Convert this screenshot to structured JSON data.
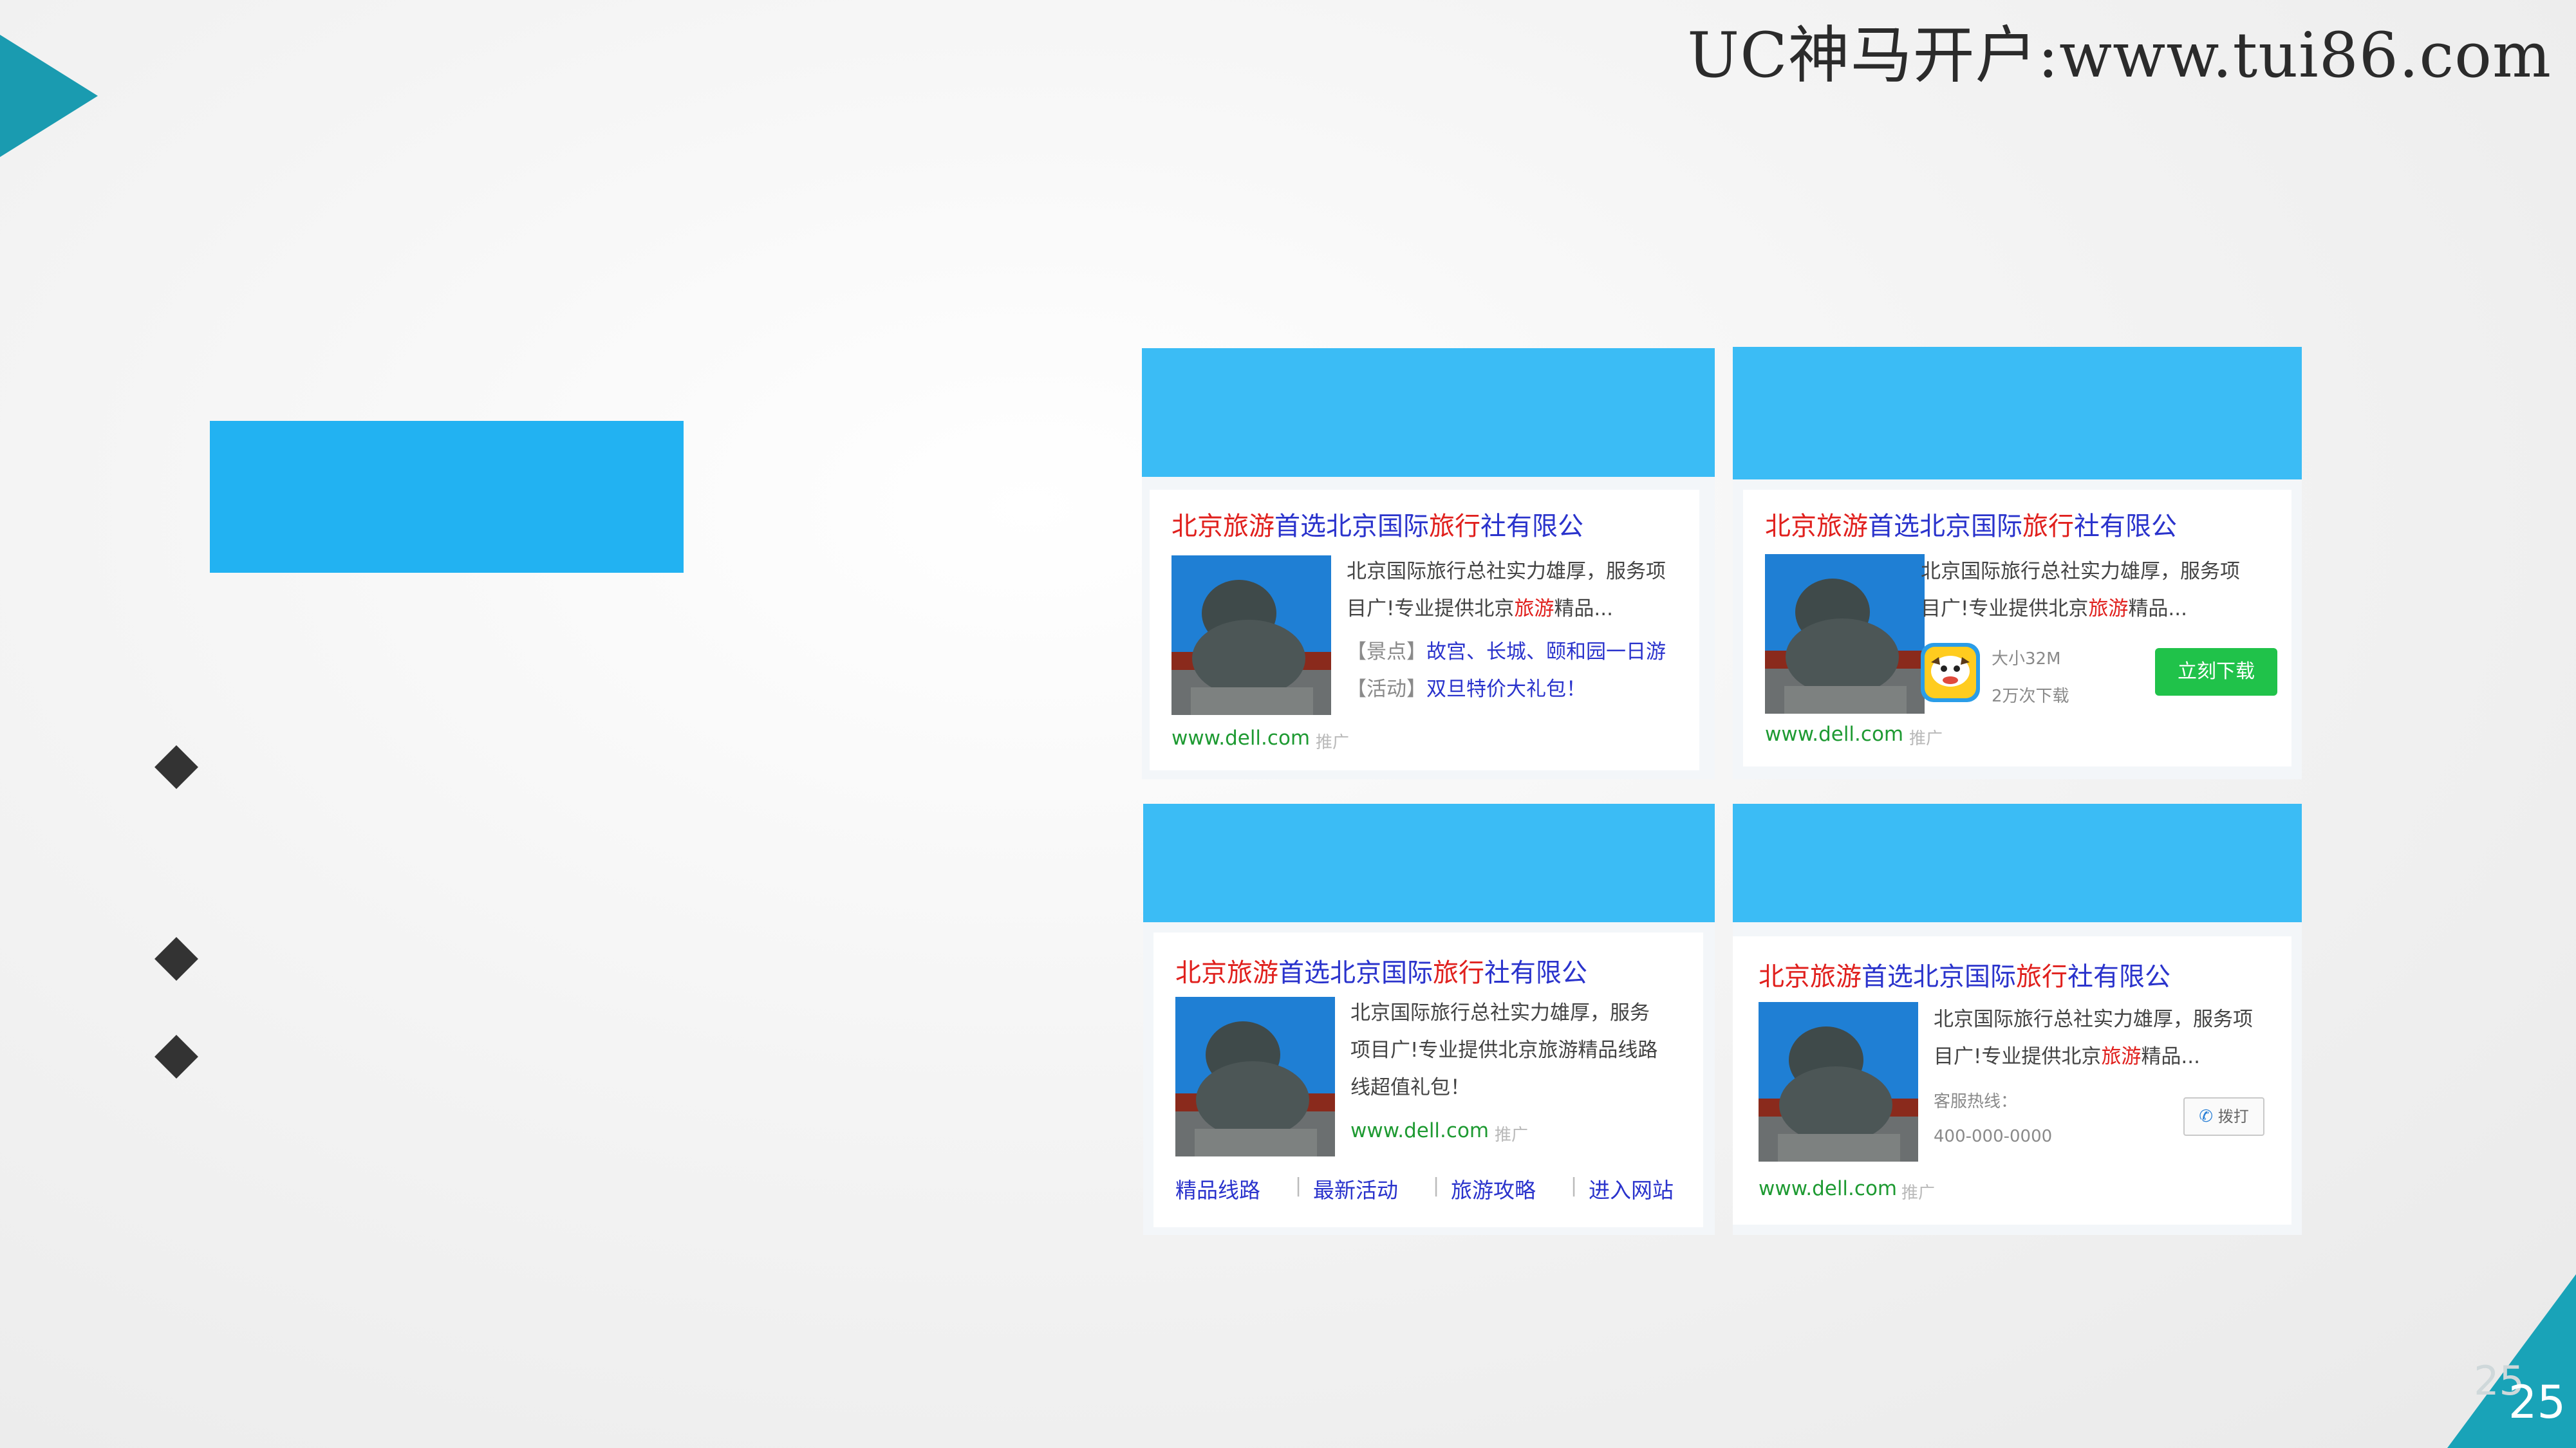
{
  "header": {
    "brand": "UC神马开户:www.tui86.com"
  },
  "page": {
    "number": "25",
    "number_shadow": "25"
  },
  "colors": {
    "accent_teal": "#1a9bb0",
    "card_blue": "#3bbcf5",
    "block_blue": "#22b2f2",
    "download_green": "#20c24a"
  },
  "cards": [
    {
      "title_red": "北京旅游",
      "title_blue_1": "首选北京国际",
      "title_red_2": "旅行",
      "title_blue_2": "社有限公",
      "desc_1": "北京国际旅行总社实力雄厚，服务项",
      "desc_2": "目广!专业提供北京",
      "desc_red": "旅游",
      "desc_3": "精品...",
      "row1_key": "【景点】",
      "row1_val": "故宫、长城、颐和园一日游",
      "row2_key": "【活动】",
      "row2_val": "双旦特价大礼包！",
      "url": "www.dell.com",
      "tag": "推广"
    },
    {
      "title_red": "北京旅游",
      "title_blue_1": "首选北京国际",
      "title_red_2": "旅行",
      "title_blue_2": "社有限公",
      "desc_1": "北京国际旅行总社实力雄厚，服务项",
      "desc_2": "目广!专业提供北京",
      "desc_red": "旅游",
      "desc_3": "精品...",
      "app_size": "大小32M",
      "app_downloads": "2万次下载",
      "download_label": "立刻下载",
      "url": "www.dell.com",
      "tag": "推广"
    },
    {
      "title_red": "北京旅游",
      "title_blue_1": "首选北京国际",
      "title_red_2": "旅行",
      "title_blue_2": "社有限公",
      "desc_1": "北京国际旅行总社实力雄厚，服务",
      "desc_2": "项目广!专业提供北京旅游精品线路",
      "desc_3": "线超值礼包！",
      "url": "www.dell.com",
      "tag": "推广",
      "links": [
        "精品线路",
        "最新活动",
        "旅游攻略",
        "进入网站"
      ],
      "link_sep": "|"
    },
    {
      "title_red": "北京旅游",
      "title_blue_1": "首选北京国际",
      "title_red_2": "旅行",
      "title_blue_2": "社有限公",
      "desc_1": "北京国际旅行总社实力雄厚，服务项",
      "desc_2": "目广!专业提供北京",
      "desc_red": "旅游",
      "desc_3": "精品...",
      "hotline_label": "客服热线：",
      "hotline_number": "400-000-0000",
      "call_label": "拨打",
      "url": "www.dell.com",
      "tag": "推广"
    }
  ]
}
